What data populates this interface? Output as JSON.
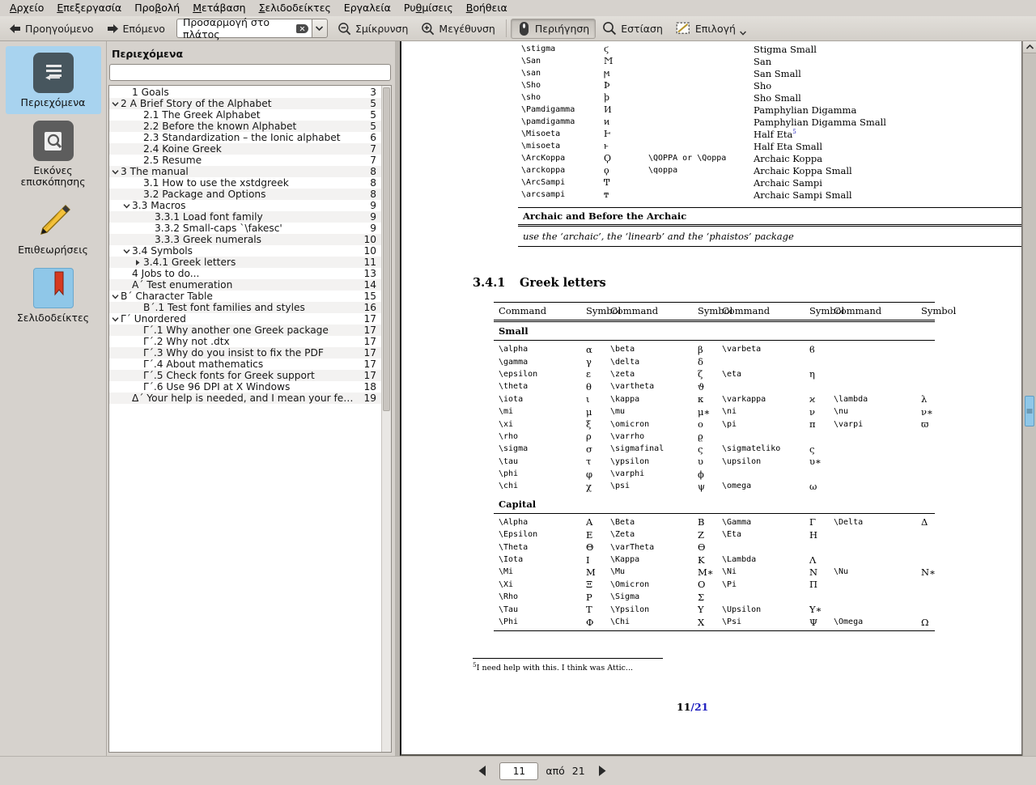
{
  "menu": {
    "items": [
      {
        "label": "Αρχείο",
        "mnemonic": "Α"
      },
      {
        "label": "Επεξεργασία",
        "mnemonic": "Ε"
      },
      {
        "label": "Προβολή",
        "mnemonic": "β"
      },
      {
        "label": "Μετάβαση",
        "mnemonic": "Μ"
      },
      {
        "label": "Σελιδοδείκτες",
        "mnemonic": "Σ"
      },
      {
        "label": "Εργαλεία",
        "mnemonic": ""
      },
      {
        "label": "Ρυθμίσεις",
        "mnemonic": "θ"
      },
      {
        "label": "Βοήθεια",
        "mnemonic": "Β"
      }
    ]
  },
  "toolbar": {
    "prev_label": "Προηγούμενο",
    "next_label": "Επόμενο",
    "zoom_value": "Προσαρμογή στο πλάτος",
    "zoom_out_label": "Σμίκρυνση",
    "zoom_in_label": "Μεγέθυνση",
    "browse_label": "Περιήγηση",
    "zoom_tool_label": "Εστίαση",
    "select_label": "Επιλογή"
  },
  "rail": {
    "items": [
      {
        "label": "Περιεχόμενα",
        "icon": "contents-icon",
        "active": true
      },
      {
        "label": "Εικόνες επισκόπησης",
        "icon": "thumbnails-icon",
        "active": false
      },
      {
        "label": "Επιθεωρήσεις",
        "icon": "annotations-pencil-icon",
        "active": false
      },
      {
        "label": "Σελιδοδείκτες",
        "icon": "bookmarks-icon",
        "active": false
      }
    ]
  },
  "toc": {
    "title": "Περιεχόμενα",
    "search_value": "",
    "search_placeholder": "",
    "entries": [
      {
        "indent": 1,
        "expander": "",
        "label": "1 Goals",
        "page": "3"
      },
      {
        "indent": 0,
        "expander": "down",
        "label": "2 A Brief Story of the Alphabet",
        "page": "5"
      },
      {
        "indent": 2,
        "expander": "",
        "label": "2.1 The Greek Alphabet",
        "page": "5"
      },
      {
        "indent": 2,
        "expander": "",
        "label": "2.2 Before the known Alphabet",
        "page": "5"
      },
      {
        "indent": 2,
        "expander": "",
        "label": "2.3 Standardization – the Ionic alphabet",
        "page": "6"
      },
      {
        "indent": 2,
        "expander": "",
        "label": "2.4 Koine Greek",
        "page": "7"
      },
      {
        "indent": 2,
        "expander": "",
        "label": "2.5 Resume",
        "page": "7"
      },
      {
        "indent": 0,
        "expander": "down",
        "label": "3 The manual",
        "page": "8"
      },
      {
        "indent": 2,
        "expander": "",
        "label": "3.1 How to use the xstdgreek",
        "page": "8"
      },
      {
        "indent": 2,
        "expander": "",
        "label": "3.2 Package and Options",
        "page": "8"
      },
      {
        "indent": 1,
        "expander": "down",
        "label": "3.3 Macros",
        "page": "9"
      },
      {
        "indent": 3,
        "expander": "",
        "label": "3.3.1 Load font family",
        "page": "9"
      },
      {
        "indent": 3,
        "expander": "",
        "label": "3.3.2 Small-caps `\\fakesc'",
        "page": "9"
      },
      {
        "indent": 3,
        "expander": "",
        "label": "3.3.3 Greek numerals",
        "page": "10"
      },
      {
        "indent": 1,
        "expander": "down",
        "label": "3.4 Symbols",
        "page": "10"
      },
      {
        "indent": 2,
        "expander": "right",
        "label": "3.4.1 Greek letters",
        "page": "11"
      },
      {
        "indent": 1,
        "expander": "",
        "label": "4 Jobs to do...",
        "page": "13"
      },
      {
        "indent": 1,
        "expander": "",
        "label": "Α΄ Test enumeration",
        "page": "14"
      },
      {
        "indent": 0,
        "expander": "down",
        "label": "Β΄ Character Table",
        "page": "15"
      },
      {
        "indent": 2,
        "expander": "",
        "label": "Β΄.1 Test font families and styles",
        "page": "16"
      },
      {
        "indent": 0,
        "expander": "down",
        "label": "Γ΄ Unordered",
        "page": "17"
      },
      {
        "indent": 2,
        "expander": "",
        "label": "Γ΄.1 Why another one Greek package",
        "page": "17"
      },
      {
        "indent": 2,
        "expander": "",
        "label": "Γ΄.2 Why not .dtx",
        "page": "17"
      },
      {
        "indent": 2,
        "expander": "",
        "label": "Γ΄.3 Why do you insist to fix the PDF",
        "page": "17"
      },
      {
        "indent": 2,
        "expander": "",
        "label": "Γ΄.4 About mathematics",
        "page": "17"
      },
      {
        "indent": 2,
        "expander": "",
        "label": "Γ΄.5 Check fonts for Greek support",
        "page": "17"
      },
      {
        "indent": 2,
        "expander": "",
        "label": "Γ΄.6 Use 96 DPI at X Windows",
        "page": "18"
      },
      {
        "indent": 1,
        "expander": "",
        "label": "Δ΄ Your help is needed, and I mean your feedback",
        "page": "19"
      }
    ]
  },
  "document": {
    "top_rows": [
      {
        "cmd": "\\stigma",
        "sym": "ϛ",
        "alt": "",
        "desc": "Stigma Small"
      },
      {
        "cmd": "\\San",
        "sym": "Ϻ",
        "alt": "",
        "desc": "San"
      },
      {
        "cmd": "\\san",
        "sym": "ϻ",
        "alt": "",
        "desc": "San Small"
      },
      {
        "cmd": "\\Sho",
        "sym": "Ϸ",
        "alt": "",
        "desc": "Sho"
      },
      {
        "cmd": "\\sho",
        "sym": "ϸ",
        "alt": "",
        "desc": "Sho Small"
      },
      {
        "cmd": "\\Pamdigamma",
        "sym": "Ͷ",
        "alt": "",
        "desc": "Pamphylian Digamma"
      },
      {
        "cmd": "\\pamdigamma",
        "sym": "ͷ",
        "alt": "",
        "desc": "Pamphylian Digamma Small"
      },
      {
        "cmd": "\\Misoeta",
        "sym": "Ͱ",
        "alt": "",
        "desc": "Half Eta",
        "sup": "5"
      },
      {
        "cmd": "\\misoeta",
        "sym": "ͱ",
        "alt": "",
        "desc": "Half Eta Small"
      },
      {
        "cmd": "\\ArcKoppa",
        "sym": "Ϙ",
        "alt": "\\QOPPA or \\Qoppa",
        "desc": "Archaic Koppa"
      },
      {
        "cmd": "\\arckoppa",
        "sym": "ϙ",
        "alt": "\\qoppa",
        "desc": "Archaic Koppa Small"
      },
      {
        "cmd": "\\ArcSampi",
        "sym": "Ͳ",
        "alt": "",
        "desc": "Archaic Sampi"
      },
      {
        "cmd": "\\arcsampi",
        "sym": "ͳ",
        "alt": "",
        "desc": "Archaic Sampi Small"
      }
    ],
    "archaic_block": {
      "heading": "Archaic and Before the Archaic",
      "body": "use the ‘archaic’, the ‘linearb’ and the ‘phaistos’ package"
    },
    "section": {
      "number": "3.4.1",
      "title": "Greek letters"
    },
    "greek_table": {
      "headers": [
        "Command",
        "Symbol",
        "Command",
        "Symbol",
        "Command",
        "Symbol",
        "Command",
        "Symbol"
      ],
      "groups": [
        {
          "name": "Small",
          "rows": [
            [
              "\\alpha",
              "α",
              "\\beta",
              "β",
              "\\varbeta",
              "ϐ",
              "",
              ""
            ],
            [
              "\\gamma",
              "γ",
              "\\delta",
              "δ",
              "",
              "",
              "",
              ""
            ],
            [
              "\\epsilon",
              "ε",
              "\\zeta",
              "ζ",
              "\\eta",
              "η",
              "",
              ""
            ],
            [
              "\\theta",
              "θ",
              "\\vartheta",
              "ϑ",
              "",
              "",
              "",
              ""
            ],
            [
              "\\iota",
              "ι",
              "\\kappa",
              "κ",
              "\\varkappa",
              "ϰ",
              "\\lambda",
              "λ"
            ],
            [
              "\\mi",
              "μ",
              "\\mu",
              "μ∗",
              "\\ni",
              "ν",
              "\\nu",
              "ν∗"
            ],
            [
              "\\xi",
              "ξ",
              "\\omicron",
              "ο",
              "\\pi",
              "π",
              "\\varpi",
              "ϖ"
            ],
            [
              "\\rho",
              "ρ",
              "\\varrho",
              "ϱ",
              "",
              "",
              "",
              ""
            ],
            [
              "\\sigma",
              "σ",
              "\\sigmafinal",
              "ς",
              "\\sigmateliko",
              "ς",
              "",
              ""
            ],
            [
              "\\tau",
              "τ",
              "\\ypsilon",
              "υ",
              "\\upsilon",
              "υ∗",
              "",
              ""
            ],
            [
              "\\phi",
              "φ",
              "\\varphi",
              "ϕ",
              "",
              "",
              "",
              ""
            ],
            [
              "\\chi",
              "χ",
              "\\psi",
              "ψ",
              "\\omega",
              "ω",
              "",
              ""
            ]
          ]
        },
        {
          "name": "Capital",
          "rows": [
            [
              "\\Alpha",
              "Α",
              "\\Beta",
              "Β",
              "\\Gamma",
              "Γ",
              "\\Delta",
              "Δ"
            ],
            [
              "\\Epsilon",
              "Ε",
              "\\Zeta",
              "Ζ",
              "\\Eta",
              "Η",
              "",
              ""
            ],
            [
              "\\Theta",
              "Θ",
              "\\varTheta",
              "ϴ",
              "",
              "",
              "",
              ""
            ],
            [
              "\\Iota",
              "Ι",
              "\\Kappa",
              "Κ",
              "\\Lambda",
              "Λ",
              "",
              ""
            ],
            [
              "\\Mi",
              "Μ",
              "\\Mu",
              "Μ∗",
              "\\Ni",
              "Ν",
              "\\Nu",
              "Ν∗"
            ],
            [
              "\\Xi",
              "Ξ",
              "\\Omicron",
              "Ο",
              "\\Pi",
              "Π",
              "",
              ""
            ],
            [
              "\\Rho",
              "Ρ",
              "\\Sigma",
              "Σ",
              "",
              "",
              "",
              ""
            ],
            [
              "\\Tau",
              "Τ",
              "\\Ypsilon",
              "Υ",
              "\\Upsilon",
              "Υ∗",
              "",
              ""
            ],
            [
              "\\Phi",
              "Φ",
              "\\Chi",
              "Χ",
              "\\Psi",
              "Ψ",
              "\\Omega",
              "Ω"
            ]
          ]
        }
      ]
    },
    "footnote": {
      "marker": "5",
      "text": "I need help with this. I think was Attic..."
    },
    "page_number": {
      "current": "11",
      "separator": "/",
      "total": "21"
    }
  },
  "statusbar": {
    "page_value": "11",
    "of_label": "από",
    "total_pages": "21"
  },
  "colors": {
    "selection_blue": "#a8d3ef",
    "chrome_gray": "#d6d2cd",
    "page_link_blue": "#2020c0"
  }
}
